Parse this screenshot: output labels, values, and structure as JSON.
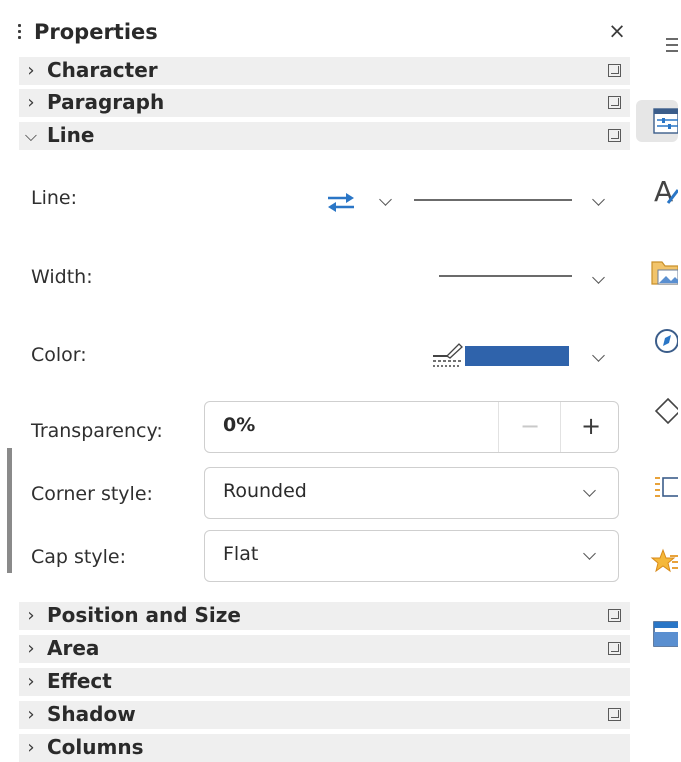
{
  "panel": {
    "title": "Properties",
    "close_label": "×"
  },
  "sections": {
    "character": "Character",
    "paragraph": "Paragraph",
    "line": "Line",
    "position_size": "Position and Size",
    "area": "Area",
    "effect": "Effect",
    "shadow": "Shadow",
    "columns": "Columns"
  },
  "line_section": {
    "line_label": "Line:",
    "width_label": "Width:",
    "color_label": "Color:",
    "transparency_label": "Transparency:",
    "transparency_value": "0%",
    "corner_label": "Corner style:",
    "corner_value": "Rounded",
    "cap_label": "Cap style:",
    "cap_value": "Flat",
    "line_color": "#2f63ab"
  },
  "icons": {
    "arrow_style": "arrow-style-icon",
    "line_color": "line-color-icon",
    "tabs": [
      "hamburger-menu-icon",
      "properties-tab-icon",
      "styles-tab-icon",
      "gallery-tab-icon",
      "navigator-tab-icon",
      "shapes-tab-icon",
      "page-tab-icon",
      "animation-tab-icon",
      "master-slides-tab-icon"
    ]
  }
}
